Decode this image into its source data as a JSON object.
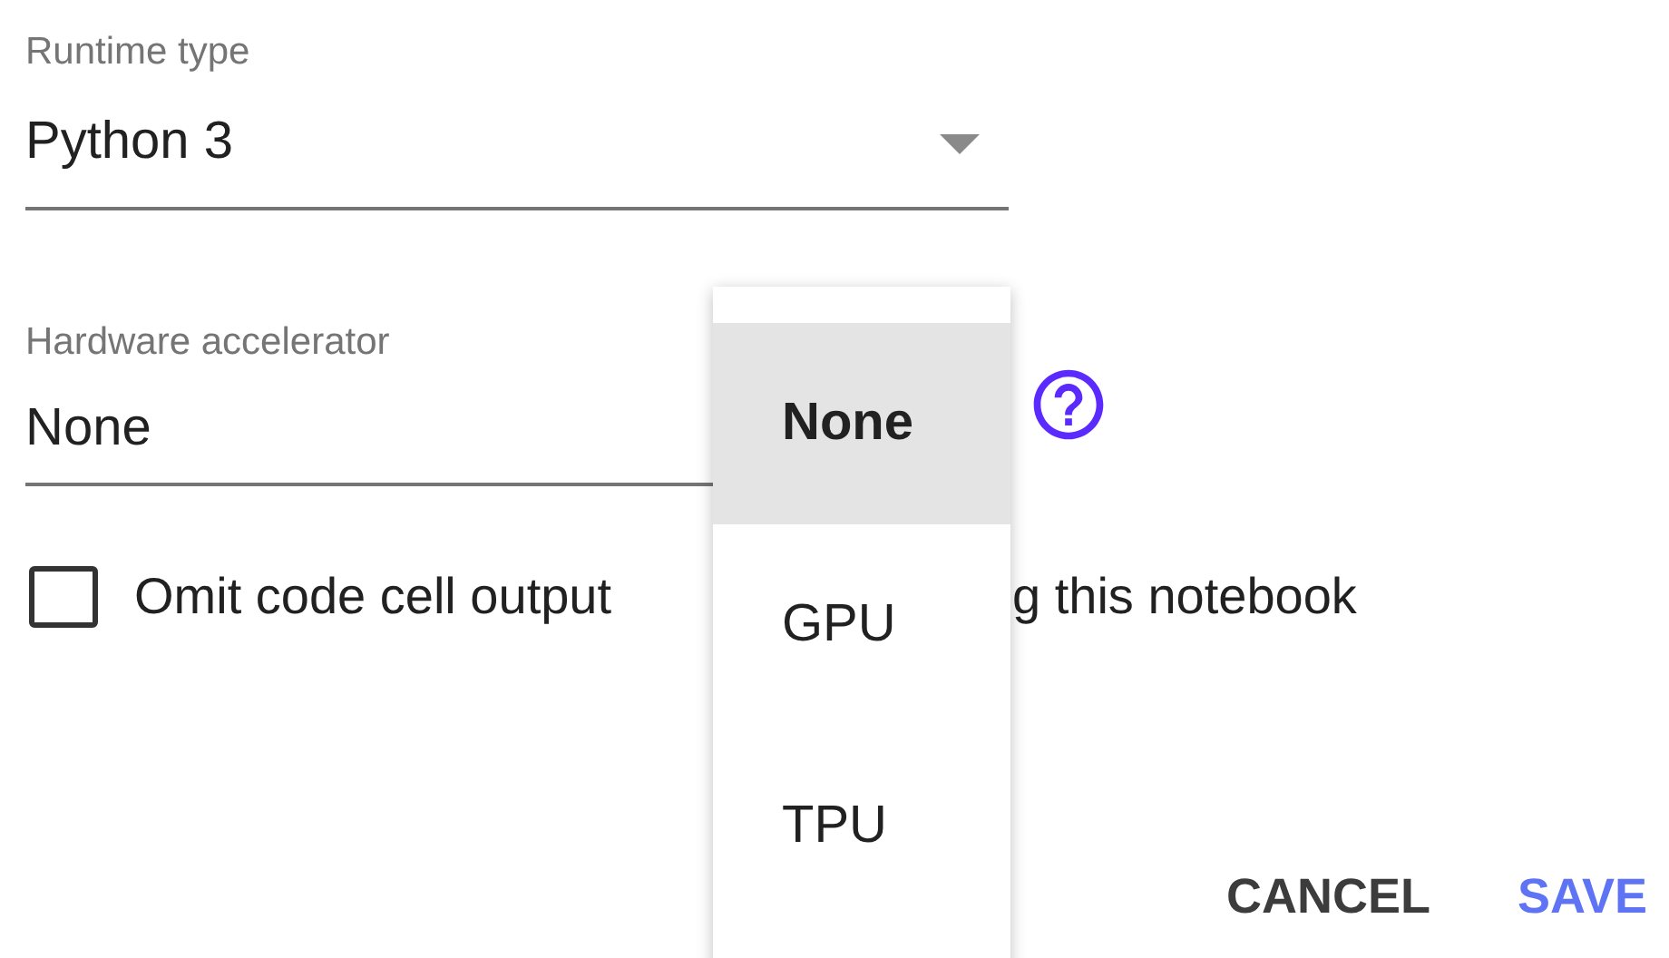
{
  "runtime": {
    "label": "Runtime type",
    "value": "Python 3"
  },
  "accelerator": {
    "label": "Hardware accelerator",
    "value": "None"
  },
  "omit_output": {
    "checked": false,
    "label_parts": [
      "Omit code cell output",
      "g this notebook"
    ]
  },
  "menu": {
    "items": [
      {
        "label": "None",
        "selected": true
      },
      {
        "label": "GPU",
        "selected": false
      },
      {
        "label": "TPU",
        "selected": false
      }
    ]
  },
  "buttons": [
    {
      "label": "CANCEL",
      "kind": "secondary"
    },
    {
      "label": "SAVE",
      "kind": "primary"
    }
  ]
}
